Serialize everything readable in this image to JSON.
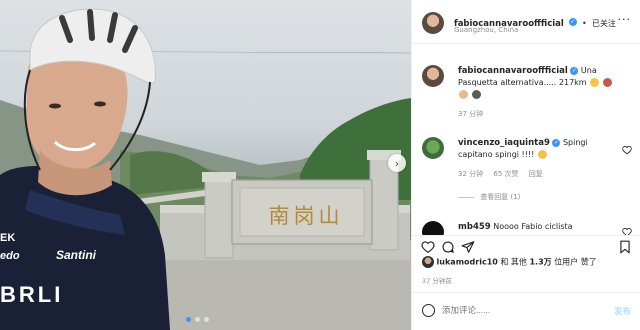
{
  "header": {
    "username": "fabiocannavarooffficial",
    "separator": "•",
    "follow_status": "已关注",
    "location": "Guangzhou, China",
    "more": "···"
  },
  "photo": {
    "inscription": "南岗山",
    "jersey_brand": "Santini",
    "jersey_text_1": "EK",
    "jersey_text_2": "edo",
    "jersey_text_3": "BRLI",
    "slide_count": 3,
    "active_slide": 1
  },
  "comments": [
    {
      "user": "fabiocannavarooffficial",
      "text": "Una Pasquetta alternativa..... 217km",
      "time": "37 分钟",
      "verified": true
    },
    {
      "user": "vincenzo_iaquinta9",
      "text": "Spingi capitano spingi !!!!",
      "time": "32 分钟",
      "likes": "65 次赞",
      "reply": "回复",
      "verified": true,
      "view_replies": "查看回复 (1)"
    },
    {
      "user": "mb459",
      "text": "Noooo Fabio ciclista",
      "verified": false
    }
  ],
  "likes": {
    "user": "lukamodric10",
    "connector": "和 其他",
    "count": "1.3万",
    "suffix": "位用户 赞了"
  },
  "timestamp": "37 分钟前",
  "add_comment": {
    "placeholder": "添加评论......",
    "post_label": "发布"
  },
  "colors": {
    "verified_blue": "#3897f0",
    "muted_text": "#8e8e8e",
    "divider": "#efefef",
    "post_disabled": "#b2dffc"
  }
}
